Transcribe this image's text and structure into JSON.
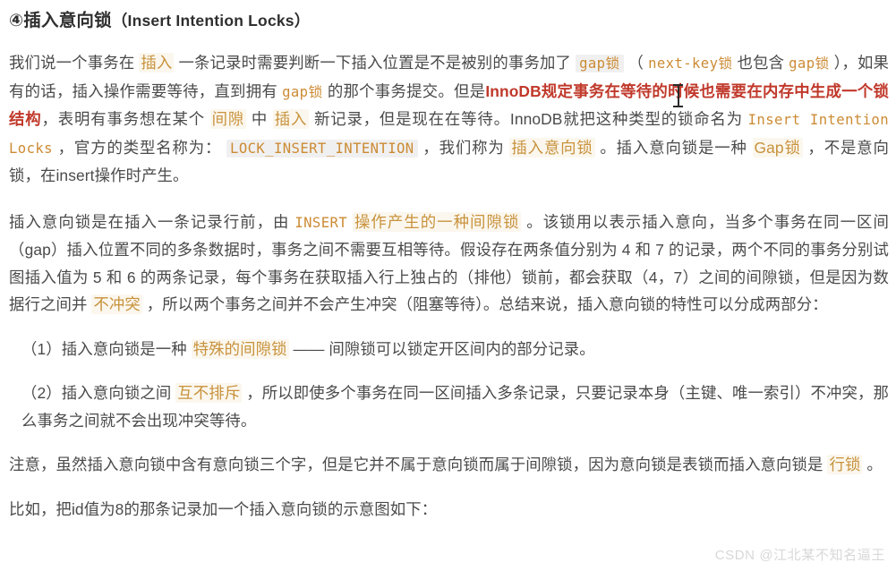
{
  "document": {
    "heading": {
      "marker": "④",
      "title_cn": "插入意向锁",
      "title_en": "（Insert Intention Locks）"
    },
    "paragraphs": [
      {
        "id": "p1",
        "segments": [
          {
            "type": "text",
            "text": "我们说一个事务在 "
          },
          {
            "type": "highlight",
            "text": "插入"
          },
          {
            "type": "text",
            "text": " 一条记录时需要判断一下插入位置是不是被别的事务加了 "
          },
          {
            "type": "code",
            "text": "gap锁"
          },
          {
            "type": "text",
            "text": " （ "
          },
          {
            "type": "code-plain",
            "text": "next-key锁"
          },
          {
            "type": "text",
            "text": " 也包含 "
          },
          {
            "type": "code-plain",
            "text": "gap锁"
          },
          {
            "type": "text",
            "text": " ），如果有的话，插入操作需要等待，直到拥有 "
          },
          {
            "type": "code-plain",
            "text": "gap锁"
          },
          {
            "type": "text",
            "text": " 的那个事务提交。但是"
          },
          {
            "type": "red",
            "text": "InnoDB规定事务在等待的时候也需要在内存中生成一个锁结构"
          },
          {
            "type": "text",
            "text": "，表明有事务想在某个 "
          },
          {
            "type": "highlight",
            "text": "间隙"
          },
          {
            "type": "text",
            "text": " 中 "
          },
          {
            "type": "highlight",
            "text": "插入"
          },
          {
            "type": "text",
            "text": " 新记录，但是现在在等待。InnoDB就把这种类型的锁命名为 "
          },
          {
            "type": "code-plain",
            "text": "Insert Intention Locks"
          },
          {
            "type": "text",
            "text": " ，官方的类型名称为： "
          },
          {
            "type": "code",
            "text": "LOCK_INSERT_INTENTION"
          },
          {
            "type": "text",
            "text": " ，我们称为 "
          },
          {
            "type": "highlight",
            "text": "插入意向锁"
          },
          {
            "type": "text",
            "text": " 。插入意向锁是一种 "
          },
          {
            "type": "highlight",
            "text": "Gap锁"
          },
          {
            "type": "text",
            "text": " ，不是意向锁，在insert操作时产生。"
          }
        ]
      },
      {
        "id": "p2",
        "segments": [
          {
            "type": "text",
            "text": "插入意向锁是在插入一条记录行前，由 "
          },
          {
            "type": "code-plain",
            "text": "INSERT"
          },
          {
            "type": "text",
            "text": " "
          },
          {
            "type": "highlight",
            "text": "操作产生的一种间隙锁"
          },
          {
            "type": "text",
            "text": " 。该锁用以表示插入意向，当多个事务在同一区间（gap）插入位置不同的多条数据时，事务之间不需要互相等待。假设存在两条值分别为 4 和 7 的记录，两个不同的事务分别试图插入值为 5 和 6 的两条记录，每个事务在获取插入行上独占的（排他）锁前，都会获取（4，7）之间的间隙锁，但是因为数据行之间并 "
          },
          {
            "type": "highlight",
            "text": "不冲突"
          },
          {
            "type": "text",
            "text": " ，所以两个事务之间并不会产生冲突（阻塞等待）。总结来说，插入意向锁的特性可以分成两部分："
          }
        ]
      },
      {
        "id": "p3",
        "indent": true,
        "segments": [
          {
            "type": "text",
            "text": "（1）插入意向锁是一种 "
          },
          {
            "type": "highlight",
            "text": "特殊的间隙锁"
          },
          {
            "type": "text",
            "text": " —— 间隙锁可以锁定开区间内的部分记录。"
          }
        ]
      },
      {
        "id": "p4",
        "indent": true,
        "segments": [
          {
            "type": "text",
            "text": "（2）插入意向锁之间 "
          },
          {
            "type": "highlight",
            "text": "互不排斥"
          },
          {
            "type": "text",
            "text": " ，所以即使多个事务在同一区间插入多条记录，只要记录本身（主键、唯一索引）不冲突，那么事务之间就不会出现冲突等待。"
          }
        ]
      },
      {
        "id": "p5",
        "segments": [
          {
            "type": "text",
            "text": "注意，虽然插入意向锁中含有意向锁三个字，但是它并不属于意向锁而属于间隙锁，因为意向锁是表锁而插入意向锁是 "
          },
          {
            "type": "highlight",
            "text": "行锁"
          },
          {
            "type": "text",
            "text": " 。"
          }
        ]
      },
      {
        "id": "p6",
        "segments": [
          {
            "type": "text",
            "text": "比如，把id值为8的那条记录加一个插入意向锁的示意图如下："
          }
        ]
      }
    ],
    "watermark": "CSDN @江北某不知名逼王",
    "colors": {
      "highlight": "#c8923c",
      "code": "#cc8b34",
      "emphasis_red": "#c0392b",
      "body_text": "#4a4a4a",
      "watermark": "#d8d8d8"
    }
  }
}
